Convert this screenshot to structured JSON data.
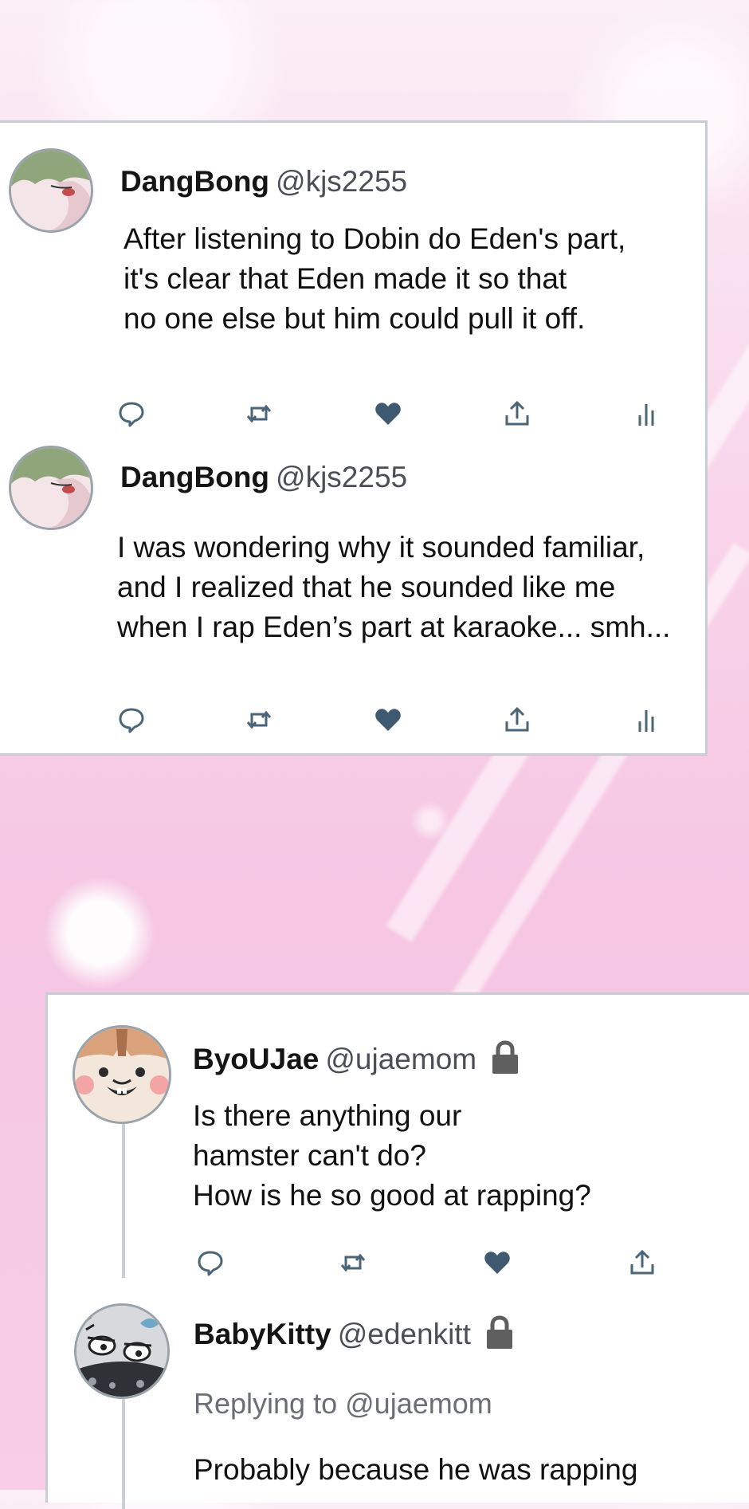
{
  "tweets": [
    {
      "name": "DangBong",
      "handle": "@kjs2255",
      "text": "After listening to Dobin do Eden's part,\nit's clear that Eden made it so that\nno one else but him could pull it off."
    },
    {
      "name": "DangBong",
      "handle": "@kjs2255",
      "text": "I was wondering why it sounded familiar,\nand I realized that he sounded like me\nwhen I rap Eden’s part at karaoke... smh..."
    }
  ],
  "replies": [
    {
      "name": "ByoUJae",
      "handle": "@ujaemom",
      "text": "Is there anything our\nhamster can't  do?\nHow is he so good at rapping?"
    },
    {
      "name": "BabyKitty",
      "handle": "@edenkitt",
      "replying_label": "Replying to",
      "replying_handle": "@ujaemom",
      "text": "Probably because he was rapping"
    }
  ],
  "icons": {
    "reply": "speech-bubble-icon",
    "retweet": "retweet-icon",
    "like": "heart-icon",
    "share": "share-icon",
    "analytics": "analytics-icon",
    "lock": "lock-icon"
  },
  "colors": {
    "icon": "#4a6478",
    "heart": "#3f5a70",
    "background": "#f7cde7"
  }
}
